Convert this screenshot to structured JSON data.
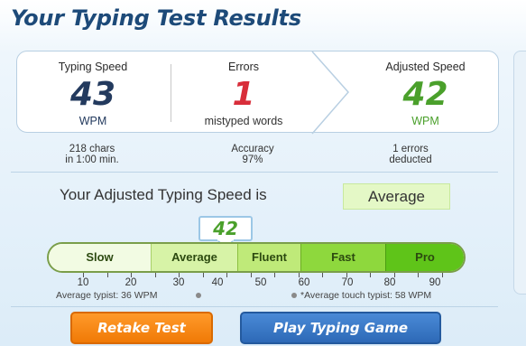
{
  "page": {
    "title": "Your Typing Test Results"
  },
  "results": {
    "typing_speed": {
      "label": "Typing Speed",
      "value": "43",
      "unit": "WPM",
      "color": "#233a5e"
    },
    "errors": {
      "label": "Errors",
      "value": "1",
      "unit": "mistyped words",
      "color": "#d82e3a"
    },
    "adjusted_speed": {
      "label": "Adjusted Speed",
      "value": "42",
      "unit": "WPM",
      "color": "#4aa02b"
    }
  },
  "sub_stats": {
    "chars_line1": "218 chars",
    "chars_line2": "in 1:00 min.",
    "accuracy_line1": "Accuracy",
    "accuracy_line2": "97%",
    "deducted_line1": "1 errors",
    "deducted_line2": "deducted"
  },
  "assessment": {
    "text": "Your Adjusted Typing Speed is",
    "level": "Average"
  },
  "scale": {
    "score": "42",
    "score_value": 42,
    "segments": [
      "Slow",
      "Average",
      "Fluent",
      "Fast",
      "Pro"
    ],
    "tick_labels": [
      "10",
      "20",
      "30",
      "40",
      "50",
      "60",
      "70",
      "80",
      "90"
    ],
    "average_typist": "Average typist: 36 WPM",
    "average_touch_typist": "*Average touch typist: 58 WPM"
  },
  "buttons": {
    "retake": "Retake Test",
    "play_game": "Play Typing Game"
  },
  "colors": {
    "accent_green": "#4aa02b",
    "error_red": "#d82e3a",
    "title_blue": "#1d4a79",
    "retake_orange": "#f07a06",
    "game_blue": "#2d69b7"
  }
}
